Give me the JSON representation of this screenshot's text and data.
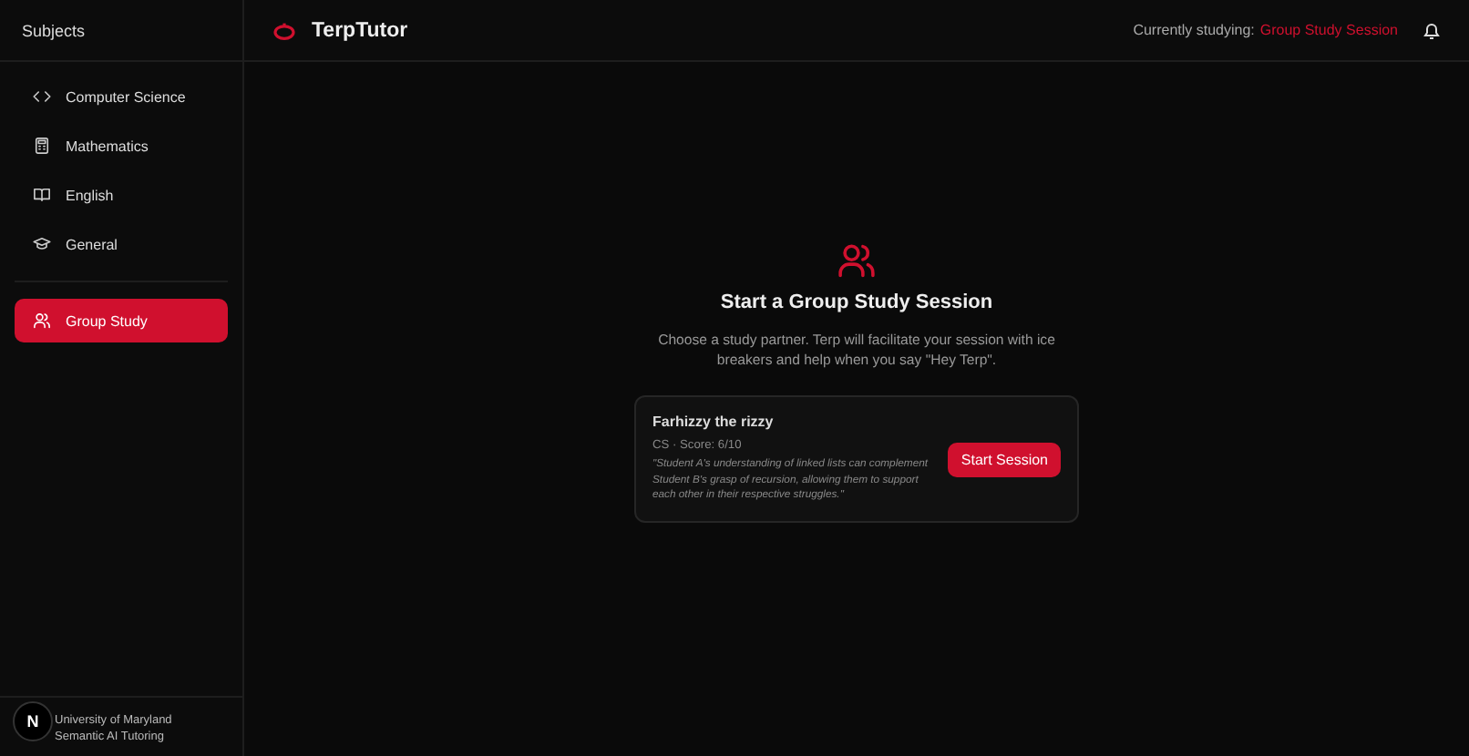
{
  "sidebar": {
    "title": "Subjects",
    "items": [
      {
        "label": "Computer Science",
        "kind": "code",
        "selected": false
      },
      {
        "label": "Mathematics",
        "kind": "calculator",
        "selected": false
      },
      {
        "label": "English",
        "kind": "book",
        "selected": false
      },
      {
        "label": "General",
        "kind": "cap",
        "selected": false
      },
      {
        "label": "Group Study",
        "kind": "users",
        "selected": true
      }
    ],
    "footer": [
      "University of Maryland",
      "Semantic AI Tutoring"
    ],
    "badge": "N"
  },
  "header": {
    "app_name": "TerpTutor",
    "status_label": "Currently studying:",
    "status_value": "Group Study Session"
  },
  "main": {
    "title": "Start a Group Study Session",
    "description": "Choose a study partner. Terp will facilitate your session with ice breakers and help when you say \"Hey Terp\".",
    "partners": [
      {
        "name": "Farhizzy the rizzy",
        "meta": "CS · Score: 6/10",
        "quote": "\"Student A's understanding of linked lists can complement Student B's grasp of recursion, allowing them to support each other in their respective struggles.\"",
        "button": "Start Session"
      }
    ]
  }
}
